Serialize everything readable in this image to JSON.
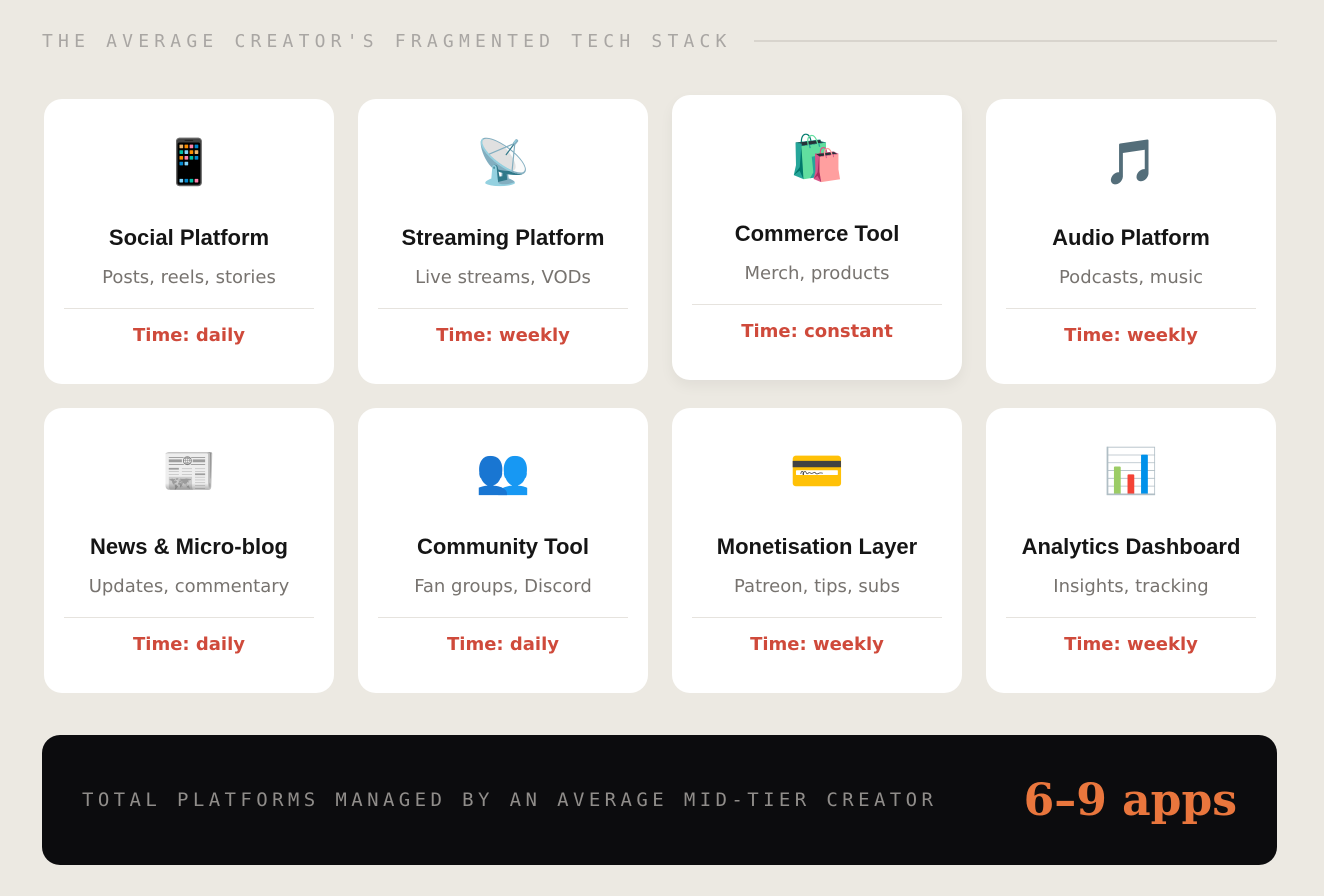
{
  "header": {
    "title": "THE AVERAGE CREATOR'S FRAGMENTED TECH STACK"
  },
  "cards": [
    {
      "icon": "mobile-phone-icon",
      "glyph": "📱",
      "title": "Social Platform",
      "subtitle": "Posts, reels, stories",
      "time": "Time: daily"
    },
    {
      "icon": "satellite-dish-icon",
      "glyph": "📡",
      "title": "Streaming Platform",
      "subtitle": "Live streams, VODs",
      "time": "Time: weekly"
    },
    {
      "icon": "shopping-bags-icon",
      "glyph": "🛍️",
      "title": "Commerce Tool",
      "subtitle": "Merch, products",
      "time": "Time: constant"
    },
    {
      "icon": "music-notes-icon",
      "glyph": "🎵",
      "title": "Audio Platform",
      "subtitle": "Podcasts, music",
      "time": "Time: weekly"
    },
    {
      "icon": "newspaper-icon",
      "glyph": "📰",
      "title": "News & Micro-blog",
      "subtitle": "Updates, commentary",
      "time": "Time: daily"
    },
    {
      "icon": "people-silhouette-icon",
      "glyph": "👥",
      "title": "Community Tool",
      "subtitle": "Fan groups, Discord",
      "time": "Time: daily"
    },
    {
      "icon": "credit-card-icon",
      "glyph": "💳",
      "title": "Monetisation Layer",
      "subtitle": "Patreon, tips, subs",
      "time": "Time: weekly"
    },
    {
      "icon": "bar-chart-icon",
      "glyph": "📊",
      "title": "Analytics Dashboard",
      "subtitle": "Insights, tracking",
      "time": "Time: weekly"
    }
  ],
  "footer": {
    "label": "TOTAL PLATFORMS MANAGED BY AN AVERAGE MID-TIER CREATOR",
    "value": "6–9 apps"
  },
  "colors": {
    "background": "#ece9e2",
    "card": "#ffffff",
    "time_accent": "#cf4a3b",
    "footer_bg": "#0c0c0e",
    "footer_value": "#e9763d"
  }
}
